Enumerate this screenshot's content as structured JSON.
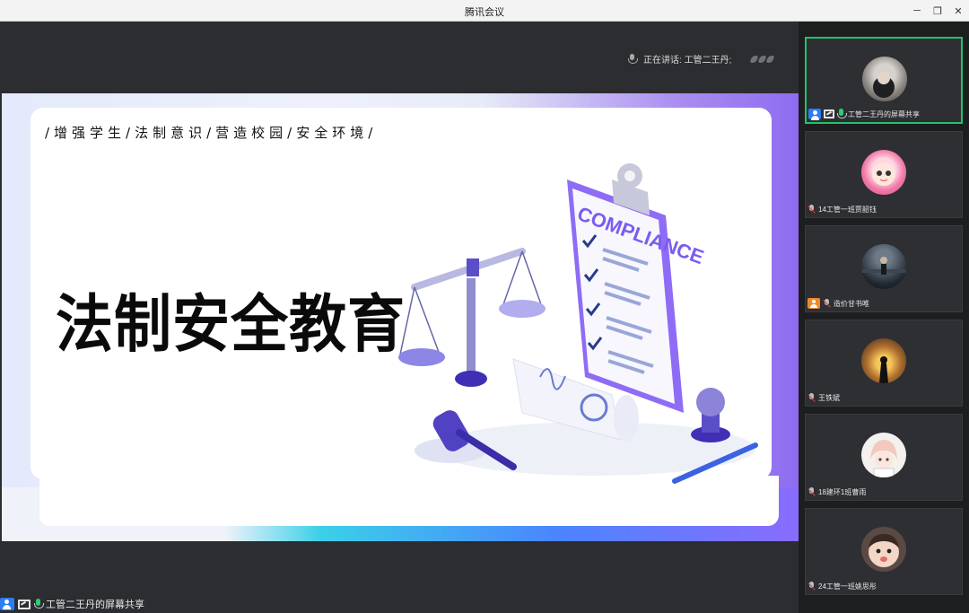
{
  "window": {
    "title": "腾讯会议"
  },
  "stage": {
    "speaking_label": "正在讲话:",
    "speaking_name": "工管二王丹;"
  },
  "slide": {
    "slogan": "/增强学生/法制意识/营造校园/安全环境/",
    "headline": "法制安全教育",
    "clipboard_text": "COMPLIANCE"
  },
  "share_label": "工管二王丹的屏幕共享",
  "participants": [
    {
      "name": "工管二王丹的屏幕共享",
      "icon": "user-icon",
      "state": "sharing"
    },
    {
      "name": "14工管一班贾韶钰",
      "icon": "muted-mic-icon",
      "state": "muted"
    },
    {
      "name": "造价甘书唯",
      "icon": "user-icon",
      "state": "muted"
    },
    {
      "name": "王铁斌",
      "icon": "muted-mic-icon",
      "state": "muted"
    },
    {
      "name": "18建环1班曹雨",
      "icon": "muted-mic-icon",
      "state": "muted"
    },
    {
      "name": "24工管一班姚思彤",
      "icon": "muted-mic-icon",
      "state": "muted"
    }
  ],
  "colors": {
    "accent_green": "#23c16b",
    "brand_blue": "#2b7cf6",
    "slide_purple": "#7b5cf0"
  }
}
